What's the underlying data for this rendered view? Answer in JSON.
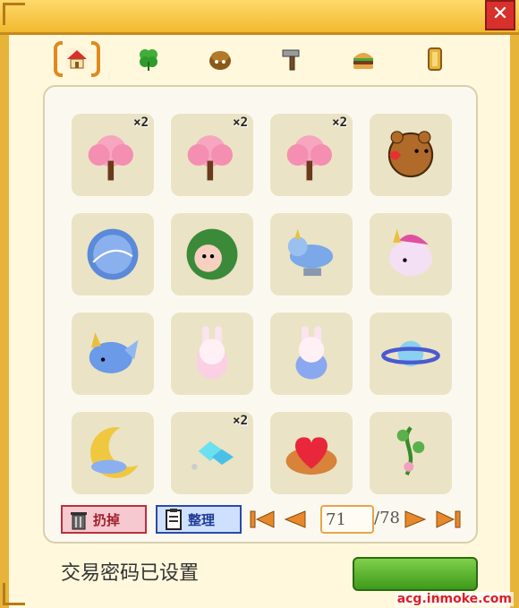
{
  "window": {
    "close_glyph": "✕"
  },
  "tabs": [
    {
      "name": "house-icon",
      "active": true
    },
    {
      "name": "clover-icon",
      "active": false
    },
    {
      "name": "chestnut-icon",
      "active": false
    },
    {
      "name": "hammer-icon",
      "active": false
    },
    {
      "name": "burger-icon",
      "active": false
    },
    {
      "name": "scroll-icon",
      "active": false
    }
  ],
  "items": [
    {
      "icon": "cherry-blossom-tree-icon",
      "count": "×2"
    },
    {
      "icon": "cherry-blossom-tree-icon",
      "count": "×2"
    },
    {
      "icon": "cherry-blossom-tree-icon",
      "count": "×2"
    },
    {
      "icon": "bear-holding-heart-icon",
      "count": ""
    },
    {
      "icon": "yin-yang-orb-icon",
      "count": ""
    },
    {
      "icon": "hedgehog-plant-icon",
      "count": ""
    },
    {
      "icon": "blue-unicorn-statue-icon",
      "count": ""
    },
    {
      "icon": "pink-unicorn-plush-icon",
      "count": ""
    },
    {
      "icon": "blue-unicorn-fish-icon",
      "count": ""
    },
    {
      "icon": "pink-bunny-icon",
      "count": ""
    },
    {
      "icon": "bunny-blue-dress-icon",
      "count": ""
    },
    {
      "icon": "planet-saturn-icon",
      "count": ""
    },
    {
      "icon": "crescent-moon-bed-icon",
      "count": ""
    },
    {
      "icon": "blue-crystals-icon",
      "count": "×2"
    },
    {
      "icon": "heart-cake-icon",
      "count": ""
    },
    {
      "icon": "flower-vine-icon",
      "count": ""
    }
  ],
  "toolbar": {
    "discard_label": "扔掉",
    "sort_label": "整理",
    "page_current": "71",
    "page_total": "/78"
  },
  "footer": {
    "status_text": "交易密码已设置",
    "watermark": "acg.inmoke.com"
  },
  "colors": {
    "frame": "#e7b43a",
    "panel": "#fbf9ef",
    "slot": "#ebe3c5",
    "confirm": "#4caf2a",
    "active_tab": "#e08a1e"
  }
}
